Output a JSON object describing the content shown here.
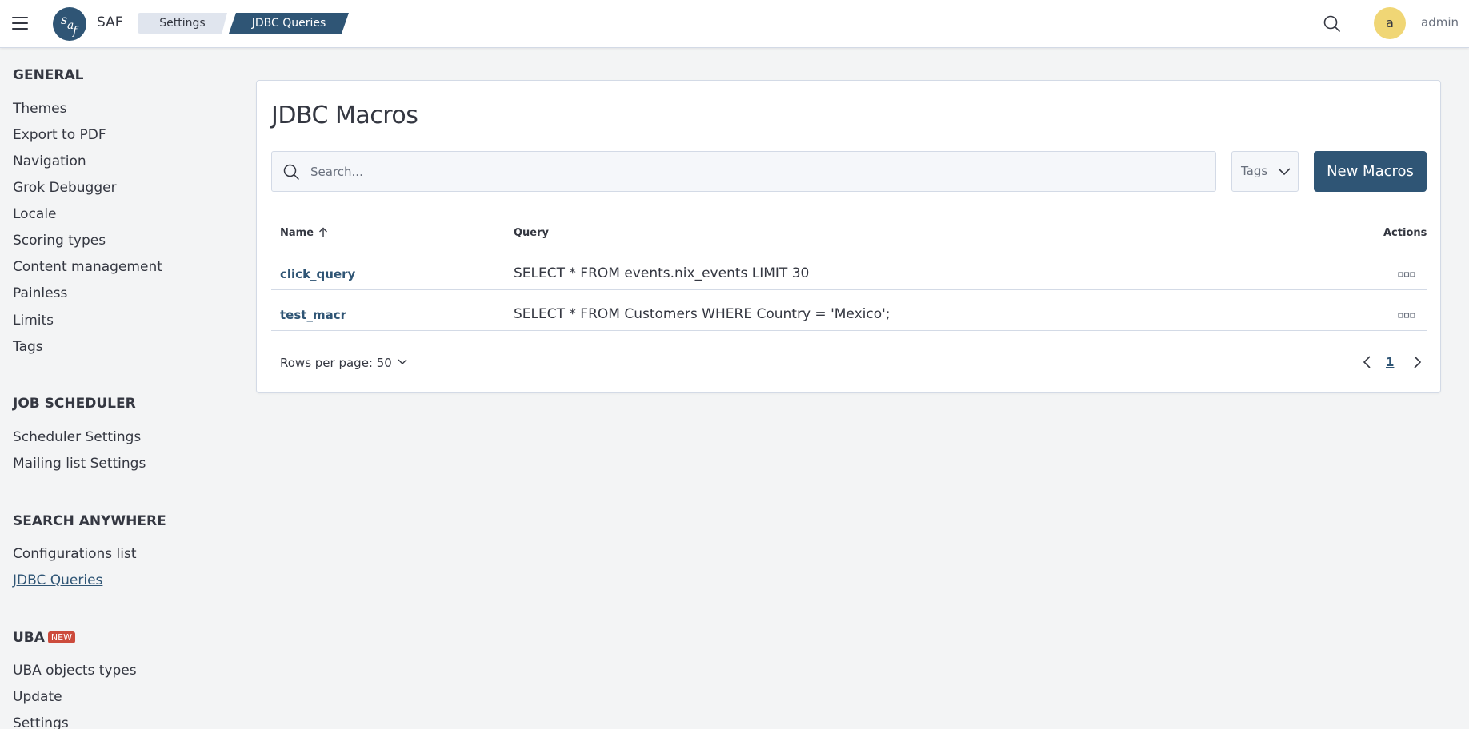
{
  "header": {
    "app_name": "SAF",
    "breadcrumbs": [
      "Settings",
      "JDBC Queries"
    ],
    "user_initial": "a",
    "username": "admin"
  },
  "sidebar": {
    "sections": [
      {
        "title": "GENERAL",
        "items": [
          "Themes",
          "Export to PDF",
          "Navigation",
          "Grok Debugger",
          "Locale",
          "Scoring types",
          "Content management",
          "Painless",
          "Limits",
          "Tags"
        ]
      },
      {
        "title": "JOB SCHEDULER",
        "items": [
          "Scheduler Settings",
          "Mailing list Settings"
        ]
      },
      {
        "title": "SEARCH ANYWHERE",
        "items": [
          "Configurations list",
          "JDBC Queries"
        ]
      },
      {
        "title": "UBA",
        "badge": "NEW",
        "items": [
          "UBA objects types",
          "Update",
          "Settings"
        ]
      }
    ],
    "active_item": "JDBC Queries"
  },
  "main": {
    "title": "JDBC Macros",
    "search_placeholder": "Search...",
    "tags_label": "Tags",
    "new_button_label": "New Macros",
    "table": {
      "columns": [
        "Name",
        "Query",
        "Actions"
      ],
      "sort": {
        "column": "Name",
        "direction": "ascending"
      },
      "rows": [
        {
          "name": "click_query",
          "query": "SELECT * FROM events.nix_events LIMIT 30"
        },
        {
          "name": "test_macr",
          "query": "SELECT * FROM Customers WHERE Country = 'Mexico';"
        }
      ]
    },
    "pagination": {
      "rows_per_page_label": "Rows per page: 50",
      "current_page": "1"
    }
  },
  "colors": {
    "primary": "#2f5575",
    "badge": "#cc4b3c",
    "avatar": "#f0d675",
    "background": "#f3f4f5"
  },
  "icons": [
    "menu-icon",
    "logo-icon",
    "search-icon",
    "chevron-down-icon",
    "sort-up-icon",
    "more-actions-icon",
    "arrow-left-icon",
    "arrow-right-icon"
  ]
}
